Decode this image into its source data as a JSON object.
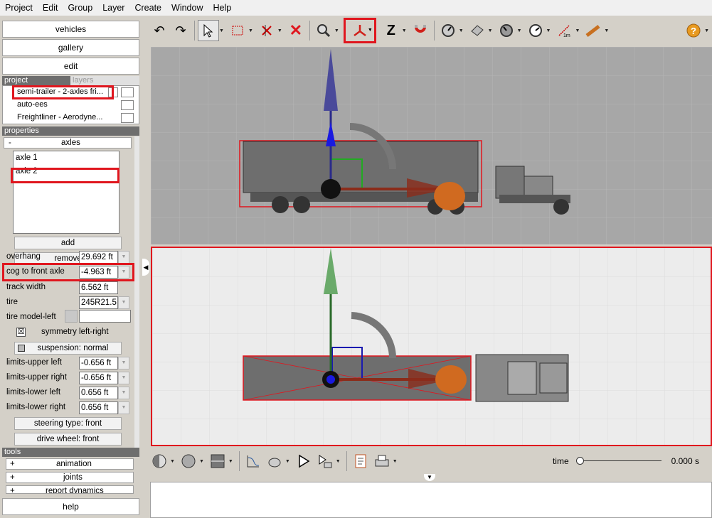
{
  "menu": [
    "Project",
    "Edit",
    "Group",
    "Layer",
    "Create",
    "Window",
    "Help"
  ],
  "left": {
    "vehicles_label": "vehicles",
    "gallery_label": "gallery",
    "edit_label": "edit",
    "project_tab": "project",
    "layers_tab": "layers",
    "project_items": [
      "semi-trailer - 2-axles fri...",
      "auto-ees",
      "Freightliner - Aerodyne..."
    ],
    "properties_header": "properties",
    "axles_collapse": "-",
    "axles_label": "axles",
    "axle_list": [
      "axle 1",
      "axle 2"
    ],
    "add_label": "add",
    "remove_label": "remove",
    "fields": [
      {
        "label": "overhang",
        "value": "29.692 ft"
      },
      {
        "label": "cog to front axle",
        "value": "-4.963 ft"
      },
      {
        "label": "track width",
        "value": "6.562 ft"
      },
      {
        "label": "tire",
        "value": "245R21.5"
      },
      {
        "label": "tire model-left",
        "value": ""
      }
    ],
    "symmetry_label": "symmetry left-right",
    "symmetry_checked": "☒",
    "suspension_label": "suspension: normal",
    "limits": [
      {
        "label": "limits-upper left",
        "value": "-0.656 ft"
      },
      {
        "label": "limits-upper right",
        "value": "-0.656 ft"
      },
      {
        "label": "limits-lower left",
        "value": "0.656 ft"
      },
      {
        "label": "limits-lower right",
        "value": "0.656 ft"
      }
    ],
    "steering_label": "steering type: front",
    "drive_label": "drive wheel: front",
    "tools_header": "tools",
    "tools": [
      {
        "sign": "+",
        "label": "animation"
      },
      {
        "sign": "+",
        "label": "joints"
      },
      {
        "sign": "+",
        "label": "report dynamics"
      }
    ],
    "help_label": "help"
  },
  "toolbar_icons": [
    "undo-icon",
    "redo-icon",
    "select-arrow-icon",
    "select-box-icon",
    "deselect-icon",
    "delete-icon",
    "zoom-icon",
    "axes-icon",
    "z-axis-icon",
    "magnet-icon",
    "measure-icon",
    "eraser-icon",
    "dial-icon",
    "gauge-icon",
    "ruler-icon",
    "pencil-icon",
    "help-icon"
  ],
  "bottom": {
    "time_label": "time",
    "time_value": "0.000 s"
  },
  "colors": {
    "highlight": "#e0161e"
  }
}
